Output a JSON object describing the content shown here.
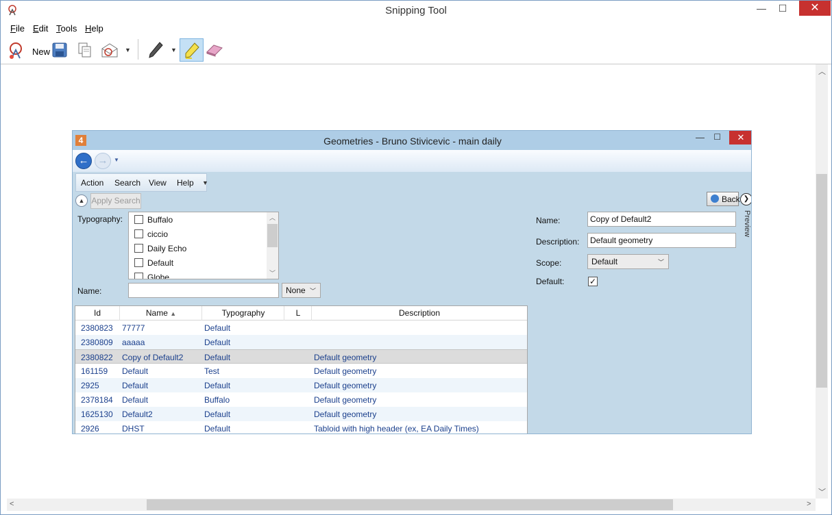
{
  "snipping_tool": {
    "title": "Snipping Tool",
    "window_controls": {
      "minimize": "—",
      "maximize": "☐",
      "close": "✕"
    },
    "menu": [
      {
        "label": "ile",
        "mnemonic": "F"
      },
      {
        "label": "dit",
        "mnemonic": "E"
      },
      {
        "label": "ools",
        "mnemonic": "T"
      },
      {
        "label": "elp",
        "mnemonic": "H"
      }
    ],
    "toolbar": {
      "new_label": "New",
      "icons": [
        "new-snip-icon",
        "save-icon",
        "copy-icon",
        "send-snip-icon",
        "pen-icon",
        "highlighter-icon",
        "eraser-icon"
      ]
    }
  },
  "geometries_window": {
    "title": "Geometries - Bruno Stivicevic - main daily",
    "app_icon_label": "4",
    "controls": {
      "minimize": "—",
      "maximize": "☐",
      "close": "✕"
    },
    "menu": [
      "Action",
      "Search",
      "View",
      "Help"
    ],
    "apply_search": "Apply Search",
    "filters": {
      "typography_label": "Typography:",
      "typography_options": [
        "Buffalo",
        "ciccio",
        "Daily Echo",
        "Default",
        "Globe"
      ],
      "name_label": "Name:",
      "name_value": "",
      "name_mode": "None"
    },
    "grid": {
      "columns": [
        "Id",
        "Name",
        "Typography",
        "L",
        "Description"
      ],
      "sort_indicator": "▲",
      "rows": [
        {
          "id": "2380823",
          "name": "77777",
          "typography": "Default",
          "l": "",
          "description": ""
        },
        {
          "id": "2380809",
          "name": "aaaaa",
          "typography": "Default",
          "l": "",
          "description": ""
        },
        {
          "id": "2380822",
          "name": "Copy of Default2",
          "typography": "Default",
          "l": "",
          "description": "Default geometry"
        },
        {
          "id": "161159",
          "name": "Default",
          "typography": "Test",
          "l": "",
          "description": "Default geometry"
        },
        {
          "id": "2925",
          "name": "Default",
          "typography": "Default",
          "l": "",
          "description": "Default geometry"
        },
        {
          "id": "2378184",
          "name": "Default",
          "typography": "Buffalo",
          "l": "",
          "description": "Default geometry"
        },
        {
          "id": "1625130",
          "name": "Default2",
          "typography": "Default",
          "l": "",
          "description": "Default geometry"
        },
        {
          "id": "2926",
          "name": "DHST",
          "typography": "Default",
          "l": "",
          "description": "Tabloid with high header (ex, EA Daily Times)"
        }
      ],
      "selected_row_index": 2
    },
    "detail": {
      "back_label": "Back",
      "preview_label": "Preview",
      "name_label": "Name:",
      "name_value": "Copy of Default2",
      "description_label": "Description:",
      "description_value": "Default geometry",
      "scope_label": "Scope:",
      "scope_value": "Default",
      "default_label": "Default:",
      "default_checked": "✓"
    }
  }
}
